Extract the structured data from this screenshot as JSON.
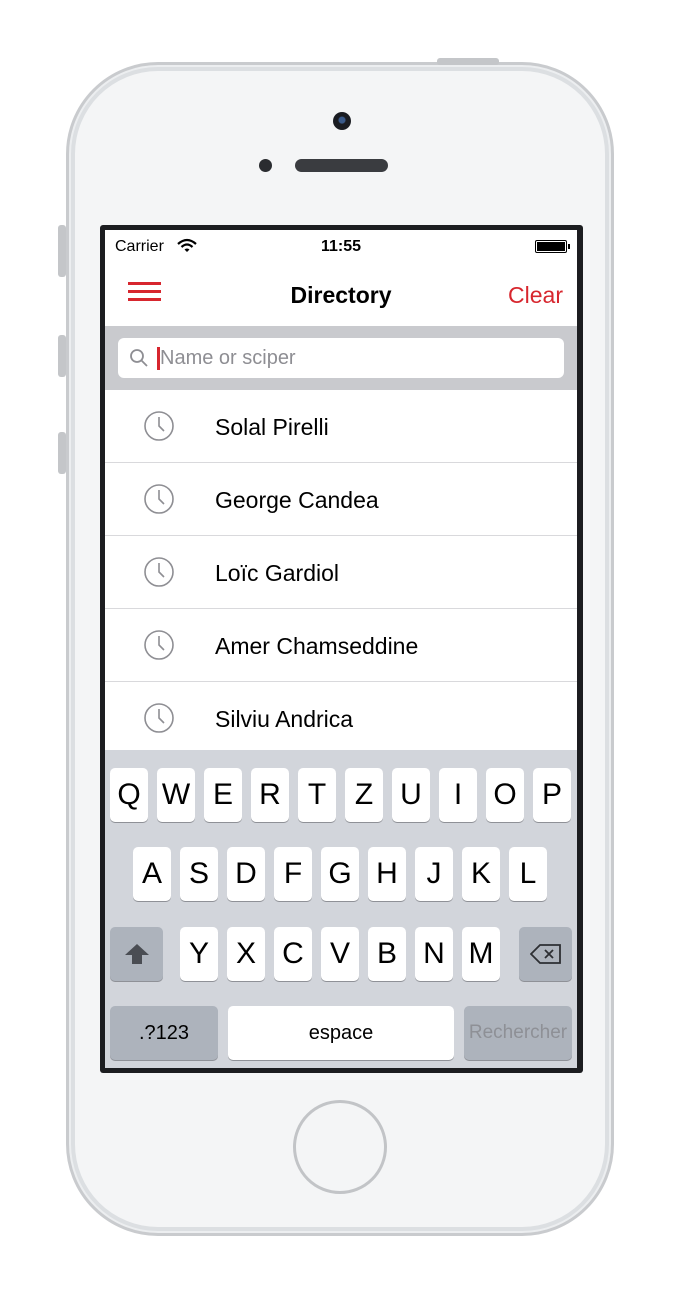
{
  "status_bar": {
    "carrier": "Carrier",
    "time": "11:55"
  },
  "nav": {
    "title": "Directory",
    "clear_label": "Clear",
    "menu_icon": "hamburger-icon"
  },
  "search": {
    "placeholder": "Name or sciper",
    "value": ""
  },
  "recent_searches": [
    {
      "name": "Solal Pirelli",
      "icon": "clock-icon"
    },
    {
      "name": "George Candea",
      "icon": "clock-icon"
    },
    {
      "name": "Loïc Gardiol",
      "icon": "clock-icon"
    },
    {
      "name": "Amer Chamseddine",
      "icon": "clock-icon"
    },
    {
      "name": "Silviu Andrica",
      "icon": "clock-icon"
    }
  ],
  "keyboard": {
    "row1": [
      "Q",
      "W",
      "E",
      "R",
      "T",
      "Z",
      "U",
      "I",
      "O",
      "P"
    ],
    "row2": [
      "A",
      "S",
      "D",
      "F",
      "G",
      "H",
      "J",
      "K",
      "L"
    ],
    "row3": [
      "Y",
      "X",
      "C",
      "V",
      "B",
      "N",
      "M"
    ],
    "numbers_label": ".?123",
    "space_label": "espace",
    "return_label": "Rechercher",
    "shift_icon": "shift-arrow-icon",
    "delete_icon": "backspace-icon"
  },
  "colors": {
    "accent": "#d7262e",
    "keyboard_bg": "#d2d5db",
    "search_bar_bg": "#c9cace"
  }
}
